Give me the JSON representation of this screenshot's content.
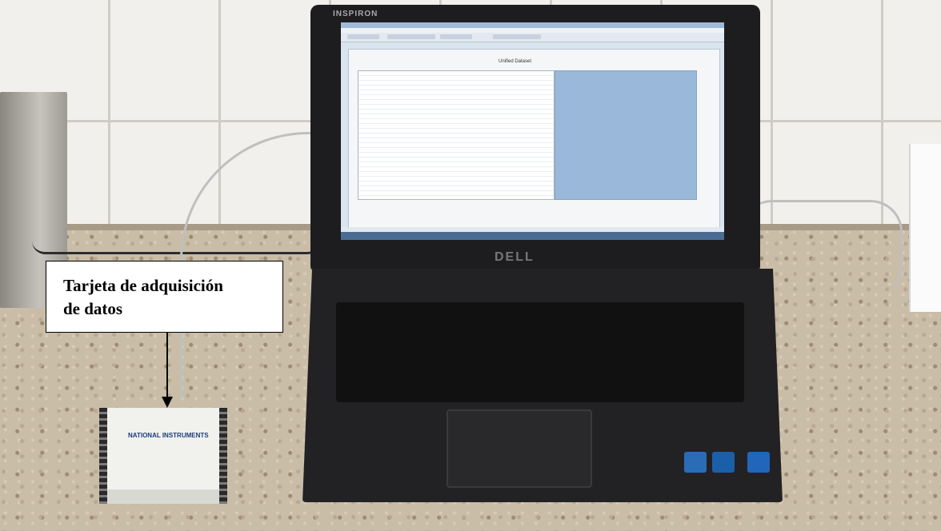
{
  "annotation": {
    "line1": "Tarjeta de adquisición",
    "line2": "de datos"
  },
  "laptop": {
    "lid_brand": "INSPIRON",
    "logo": "DELL",
    "screen": {
      "dataset_title": "Unified Dataset"
    }
  },
  "daq_device": {
    "brand": "NATIONAL INSTRUMENTS"
  }
}
